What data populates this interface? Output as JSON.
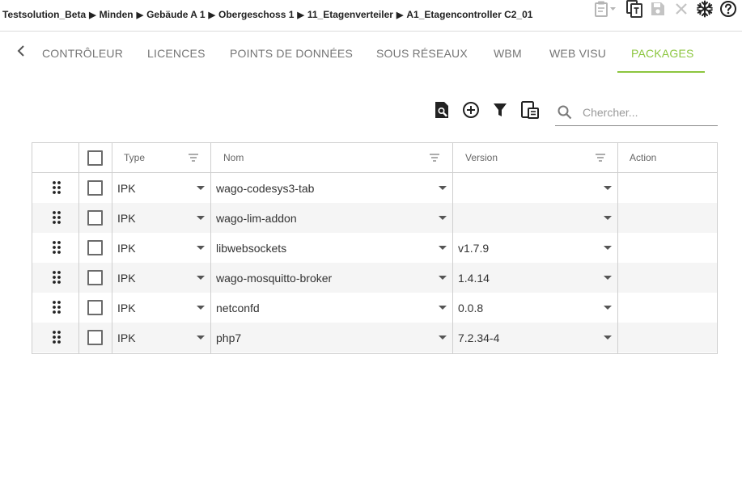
{
  "breadcrumb": [
    "Testsolution_Beta",
    "Minden",
    "Gebäude A 1",
    "Obergeschoss 1",
    "11_Etagenverteiler",
    "A1_Etagencontroller C2_01"
  ],
  "breadcrumb_separator": "▶",
  "toolbar_icons": [
    "clipboard-icon",
    "copy-icon",
    "save-icon",
    "close-icon",
    "snowflake-icon",
    "help-icon"
  ],
  "tabs": [
    {
      "label": "CONTRÔLEUR",
      "active": false
    },
    {
      "label": "LICENCES",
      "active": false
    },
    {
      "label": "POINTS DE DONNÉES",
      "active": false
    },
    {
      "label": "SOUS RÉSEAUX",
      "active": false
    },
    {
      "label": "WBM",
      "active": false
    },
    {
      "label": "WEB VISU",
      "active": false
    },
    {
      "label": "PACKAGES",
      "active": true
    }
  ],
  "accent_color": "#8cc63f",
  "search": {
    "placeholder": "Chercher..."
  },
  "table": {
    "columns": {
      "type": "Type",
      "name": "Nom",
      "version": "Version",
      "action": "Action"
    },
    "rows": [
      {
        "type": "IPK",
        "name": "wago-codesys3-tab",
        "version": "",
        "checked": false
      },
      {
        "type": "IPK",
        "name": "wago-lim-addon",
        "version": "",
        "checked": false
      },
      {
        "type": "IPK",
        "name": "libwebsockets",
        "version": "v1.7.9",
        "checked": false
      },
      {
        "type": "IPK",
        "name": "wago-mosquitto-broker",
        "version": "1.4.14",
        "checked": false
      },
      {
        "type": "IPK",
        "name": "netconfd",
        "version": "0.0.8",
        "checked": false
      },
      {
        "type": "IPK",
        "name": "php7",
        "version": "7.2.34-4",
        "checked": false
      }
    ]
  }
}
